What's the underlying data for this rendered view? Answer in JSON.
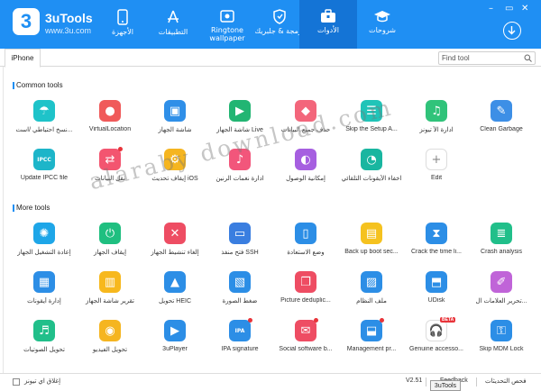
{
  "app": {
    "name": "3uTools",
    "url": "www.3u.com",
    "logo_glyph": "3",
    "accent": "#1f8ff3"
  },
  "window_controls": [
    "–",
    "▭",
    "✕"
  ],
  "nav": [
    {
      "label": "الأجهزة",
      "icon": "phone-icon",
      "active": false
    },
    {
      "label": "التطبيقات",
      "icon": "appstore-icon",
      "active": false
    },
    {
      "label": "Ringtone wallpaper",
      "icon": "ringtone-wallpaper-icon",
      "active": false
    },
    {
      "label": "برمجة & جلبريك",
      "icon": "shield-jailbreak-icon",
      "active": false
    },
    {
      "label": "الأدوات",
      "icon": "toolbox-icon",
      "active": true
    },
    {
      "label": "شروحات",
      "icon": "graduation-cap-icon",
      "active": false
    }
  ],
  "tabs": {
    "device": "iPhone",
    "find_placeholder": "Find tool"
  },
  "common": {
    "title": "Common tools",
    "tools": [
      {
        "label": "نسخ احتياطي /است...",
        "icon": "umbrella-icon",
        "color": "#1ec3c9",
        "dot": false
      },
      {
        "label": "VirtualLocation",
        "icon": "location-pin-icon",
        "color": "#f05a5a",
        "dot": false
      },
      {
        "label": "شاشة الجهاز",
        "icon": "screen-mirror-icon",
        "color": "#2f8fe8",
        "dot": false
      },
      {
        "label": "شاشة الجهاز Live",
        "icon": "live-screen-icon",
        "color": "#22b573",
        "dot": false
      },
      {
        "label": "حذف جميع البيانات",
        "icon": "eraser-icon",
        "color": "#f3667b",
        "dot": false
      },
      {
        "label": "Skip the Setup A...",
        "icon": "setup-skip-icon",
        "color": "#20c4b8",
        "dot": false
      },
      {
        "label": "ادارة الأ تيونز",
        "icon": "music-note-icon",
        "color": "#30c37a",
        "dot": false
      },
      {
        "label": "Clean Garbage",
        "icon": "broom-icon",
        "color": "#3d8fe6",
        "dot": false
      },
      {
        "label": "Update IPCC file",
        "icon": "ipcc-icon",
        "color": "#1db5c9",
        "dot": false
      },
      {
        "label": "نقل البيانات",
        "icon": "data-transfer-icon",
        "color": "#f35570",
        "dot": true
      },
      {
        "label": "إيقاف تحديث iOS",
        "icon": "gear-stop-icon",
        "color": "#f5b520",
        "dot": false
      },
      {
        "label": "ادارة نغمات الرنين",
        "icon": "ringtone-icon",
        "color": "#f2567b",
        "dot": false
      },
      {
        "label": "إمكانية الوصول",
        "icon": "toggle-icon",
        "color": "#a65fe0",
        "dot": false
      },
      {
        "label": "اخفاء الأيقونات التلقائي",
        "icon": "hide-icon",
        "color": "#19b6a0",
        "dot": false
      },
      {
        "label": "Edit",
        "icon": "add-icon",
        "color": "#ffffff",
        "dot": false
      }
    ]
  },
  "more": {
    "title": "More tools",
    "tools": [
      {
        "label": "إعادة التشغيل الجهاز",
        "icon": "reboot-icon",
        "color": "#1ea6e8",
        "dot": false
      },
      {
        "label": "إيقاف الجهاز",
        "icon": "power-icon",
        "color": "#1fbf80",
        "dot": false
      },
      {
        "label": "إلغاء تنشيط الجهاز",
        "icon": "deactivate-icon",
        "color": "#ee4d63",
        "dot": false
      },
      {
        "label": "فتح منفذ SSH",
        "icon": "ssh-terminal-icon",
        "color": "#3a7ee0",
        "dot": false
      },
      {
        "label": "وضع الاستعادة",
        "icon": "recovery-icon",
        "color": "#2c8ee6",
        "dot": false
      },
      {
        "label": "Back up boot sec...",
        "icon": "boot-backup-icon",
        "color": "#f5c21f",
        "dot": false
      },
      {
        "label": "Crack the time li...",
        "icon": "hourglass-icon",
        "color": "#2c8ee6",
        "dot": false
      },
      {
        "label": "Crash analysis",
        "icon": "crash-report-icon",
        "color": "#21bf8a",
        "dot": false
      },
      {
        "label": "إدارة أيقونات",
        "icon": "icon-manage-icon",
        "color": "#2c8ee6",
        "dot": false
      },
      {
        "label": "تقرير شاشة الجهاز",
        "icon": "report-icon",
        "color": "#f7b81d",
        "dot": false
      },
      {
        "label": "تحويل HEIC",
        "icon": "heic-icon",
        "color": "#2c8ee6",
        "dot": false
      },
      {
        "label": "ضغط الصورة",
        "icon": "compress-image-icon",
        "color": "#2c8ee6",
        "dot": false
      },
      {
        "label": "Picture deduplic...",
        "icon": "dedup-icon",
        "color": "#ee4d63",
        "dot": false
      },
      {
        "label": "ملف النظام",
        "icon": "system-file-icon",
        "color": "#2c8ee6",
        "dot": false
      },
      {
        "label": "UDisk",
        "icon": "udisk-icon",
        "color": "#2c8ee6",
        "dot": false
      },
      {
        "label": "تحرير العلامات ال...",
        "icon": "tag-edit-icon",
        "color": "#c064d8",
        "dot": false
      },
      {
        "label": "تحويل الصوتيات",
        "icon": "audio-convert-icon",
        "color": "#21bf8a",
        "dot": false
      },
      {
        "label": "تحويل الفيديو",
        "icon": "video-convert-icon",
        "color": "#f5b520",
        "dot": false
      },
      {
        "label": "3uPlayer",
        "icon": "player-icon",
        "color": "#2c8ee6",
        "dot": false
      },
      {
        "label": "IPA signature",
        "icon": "ipa-icon",
        "color": "#2c8ee6",
        "dot": true
      },
      {
        "label": "Social software b...",
        "icon": "chat-backup-icon",
        "color": "#ee4d63",
        "dot": true
      },
      {
        "label": "Management pr...",
        "icon": "management-icon",
        "color": "#2c8ee6",
        "dot": true
      },
      {
        "label": "Genuine accesso...",
        "icon": "earphones-icon",
        "color": "#ffffff",
        "dot": false,
        "badge": "BETA"
      },
      {
        "label": "Skip MDM Lock",
        "icon": "mdm-unlock-icon",
        "color": "#2c8ee6",
        "dot": false
      }
    ]
  },
  "footer": {
    "close_itunes": "إغلاق اي تيونز",
    "version": "V2.51",
    "feedback": "Feedback",
    "check_updates": "فحص التحديثات",
    "tooltip": "3uTools"
  },
  "watermark": "alaraby download.com"
}
